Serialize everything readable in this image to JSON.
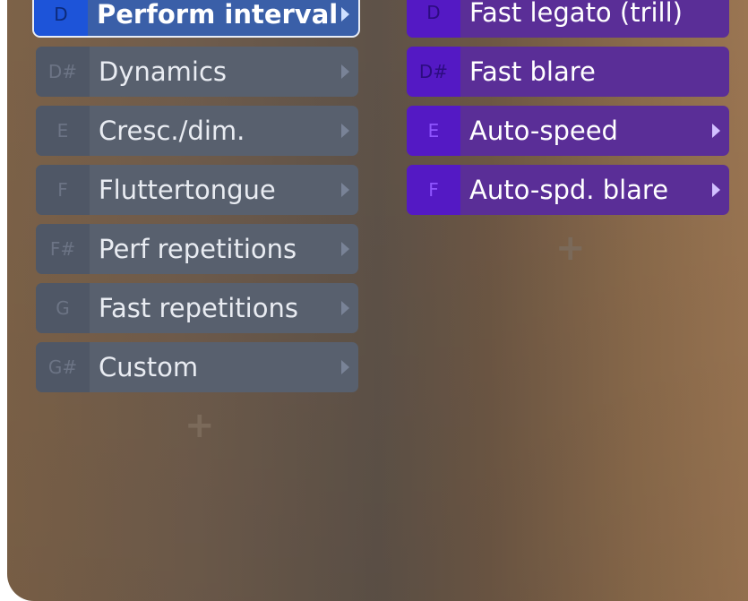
{
  "left_column": {
    "items": [
      {
        "note": "D",
        "label": "Perform interval",
        "selected": true,
        "has_submenu": true
      },
      {
        "note": "D#",
        "label": "Dynamics",
        "selected": false,
        "has_submenu": true
      },
      {
        "note": "E",
        "label": "Cresc./dim.",
        "selected": false,
        "has_submenu": true
      },
      {
        "note": "F",
        "label": "Fluttertongue",
        "selected": false,
        "has_submenu": true
      },
      {
        "note": "F#",
        "label": "Perf repetitions",
        "selected": false,
        "has_submenu": true
      },
      {
        "note": "G",
        "label": "Fast repetitions",
        "selected": false,
        "has_submenu": true
      },
      {
        "note": "G#",
        "label": "Custom",
        "selected": false,
        "has_submenu": true
      }
    ],
    "add_label": "+"
  },
  "right_column": {
    "items": [
      {
        "note": "D",
        "label": "Fast legato (trill)",
        "has_submenu": false
      },
      {
        "note": "D#",
        "label": "Fast blare",
        "has_submenu": false
      },
      {
        "note": "E",
        "label": "Auto-speed",
        "has_submenu": true
      },
      {
        "note": "F",
        "label": "Auto-spd. blare",
        "has_submenu": true
      }
    ],
    "add_label": "+"
  },
  "colors": {
    "left_item_bg": "#58606e",
    "selected_bg": "#3a5fa8",
    "selected_note_bg": "#1d54d9",
    "right_item_bg": "#5a2e97",
    "right_note_bg": "#5419c4"
  }
}
